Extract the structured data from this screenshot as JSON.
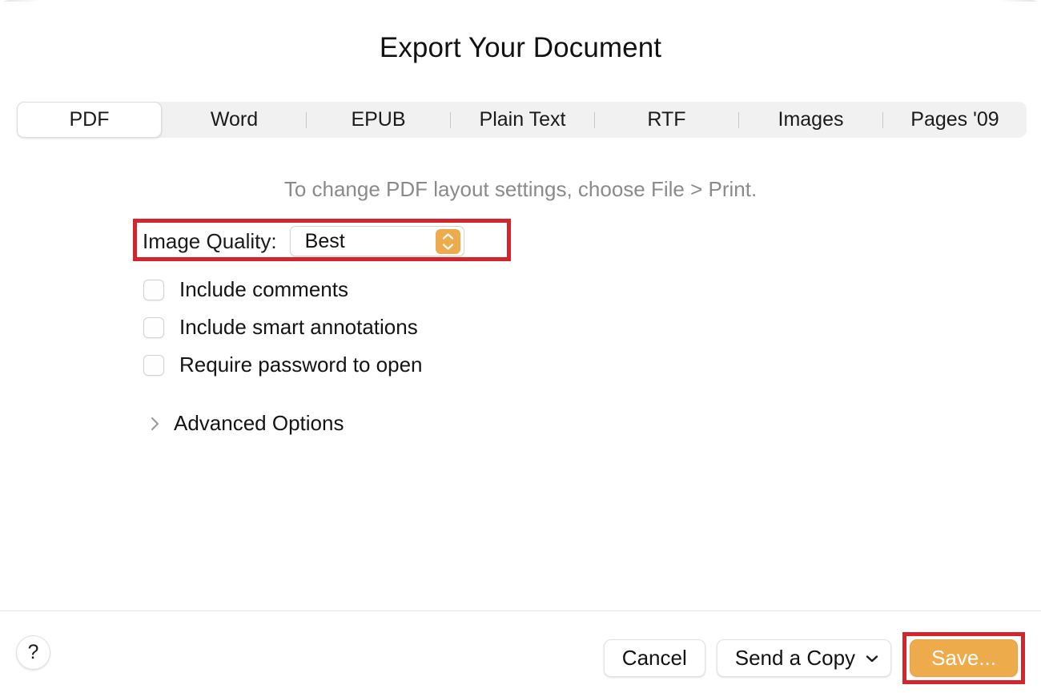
{
  "dialog": {
    "title": "Export Your Document"
  },
  "tabs": [
    {
      "label": "PDF",
      "selected": true
    },
    {
      "label": "Word",
      "selected": false
    },
    {
      "label": "EPUB",
      "selected": false
    },
    {
      "label": "Plain Text",
      "selected": false
    },
    {
      "label": "RTF",
      "selected": false
    },
    {
      "label": "Images",
      "selected": false
    },
    {
      "label": "Pages '09",
      "selected": false
    }
  ],
  "panel": {
    "hint": "To change PDF layout settings, choose File > Print.",
    "quality": {
      "label": "Image Quality:",
      "value": "Best",
      "stepper_icon": "stepper-up-down-icon",
      "highlighted": true
    },
    "checkboxes": [
      {
        "label": "Include comments",
        "checked": false
      },
      {
        "label": "Include smart annotations",
        "checked": false
      },
      {
        "label": "Require password to open",
        "checked": false
      }
    ],
    "advanced": {
      "label": "Advanced Options",
      "disclosure_icon": "chevron-right-icon",
      "expanded": false
    }
  },
  "footer": {
    "help_label": "?",
    "cancel_label": "Cancel",
    "send_copy_label": "Send a Copy",
    "send_copy_icon": "chevron-down-icon",
    "save_label": "Save...",
    "save_highlighted": true
  },
  "colors": {
    "accent": "#edab4c",
    "highlight": "#d3252b",
    "tabbar_bg": "#f1f1f1",
    "hint_text": "#8a8a8a",
    "text": "#141414"
  }
}
